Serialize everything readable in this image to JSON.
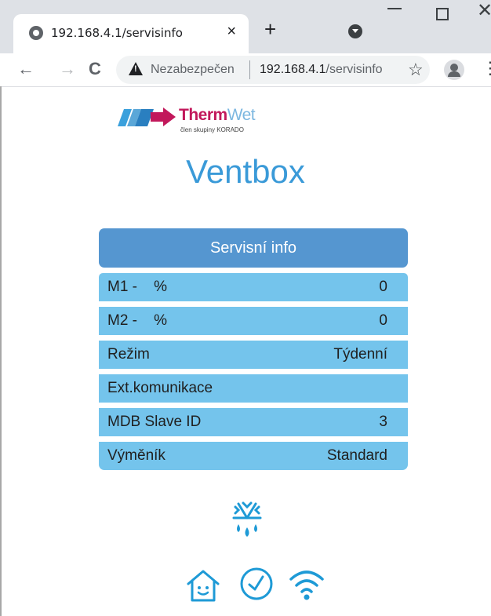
{
  "browser": {
    "tab_title": "192.168.4.1/servisinfo",
    "tab_close": "×",
    "new_tab": "+",
    "security_label": "Nezabezpečen",
    "url_host": "192.168.4.1",
    "url_path": "/servisinfo"
  },
  "logo": {
    "brand_main": "Therm",
    "brand_accent": "Wet",
    "tagline": "člen skupiny KORADO"
  },
  "page": {
    "title": "Ventbox"
  },
  "panel": {
    "header": "Servisní info",
    "rows": [
      {
        "label": "M1 -    %",
        "value": "0"
      },
      {
        "label": "M2 -    %",
        "value": "0"
      },
      {
        "label": "Režim",
        "value": "Týdenní"
      },
      {
        "label": "Ext.komunikace",
        "value": ""
      },
      {
        "label": "MDB Slave ID",
        "value": "3"
      },
      {
        "label": "Výměník",
        "value": "Standard"
      }
    ]
  },
  "icons": {
    "status": "snowflake-drops-icon",
    "nav": [
      "home-icon",
      "clock-icon",
      "wifi-icon"
    ]
  },
  "colors": {
    "title": "#3a9ad8",
    "header_bg": "#5596d0",
    "row_bg": "#74c4ec",
    "icon": "#1e9ad6"
  }
}
